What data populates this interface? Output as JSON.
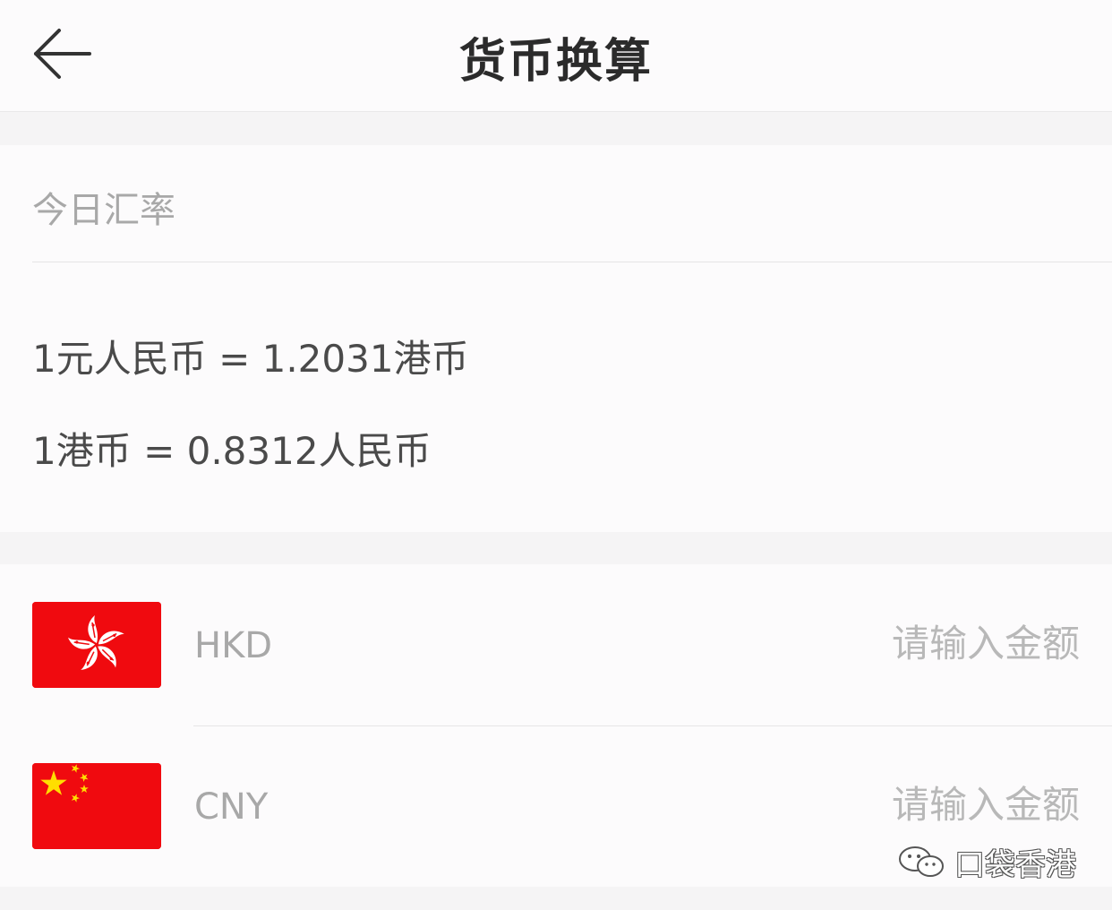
{
  "header": {
    "title": "货币换算",
    "back_icon": "back-arrow-icon"
  },
  "rates": {
    "section_title": "今日汇率",
    "cny_to_hkd": "1元人民币 = 1.2031港币",
    "hkd_to_cny": "1港币 = 0.8312人民币"
  },
  "converter": {
    "rows": [
      {
        "currency_code": "HKD",
        "flag_icon": "hong-kong-flag-icon",
        "placeholder": "请输入金额",
        "value": ""
      },
      {
        "currency_code": "CNY",
        "flag_icon": "china-flag-icon",
        "placeholder": "请输入金额",
        "value": ""
      }
    ]
  },
  "watermark": {
    "text": "口袋香港",
    "icon": "wechat-icon"
  },
  "colors": {
    "flag_red": "#f00a0f",
    "star_yellow": "#ffde00",
    "title_text": "#2b2b2b",
    "muted_text": "#a8a8a8",
    "body_text": "#4a4a4a"
  }
}
